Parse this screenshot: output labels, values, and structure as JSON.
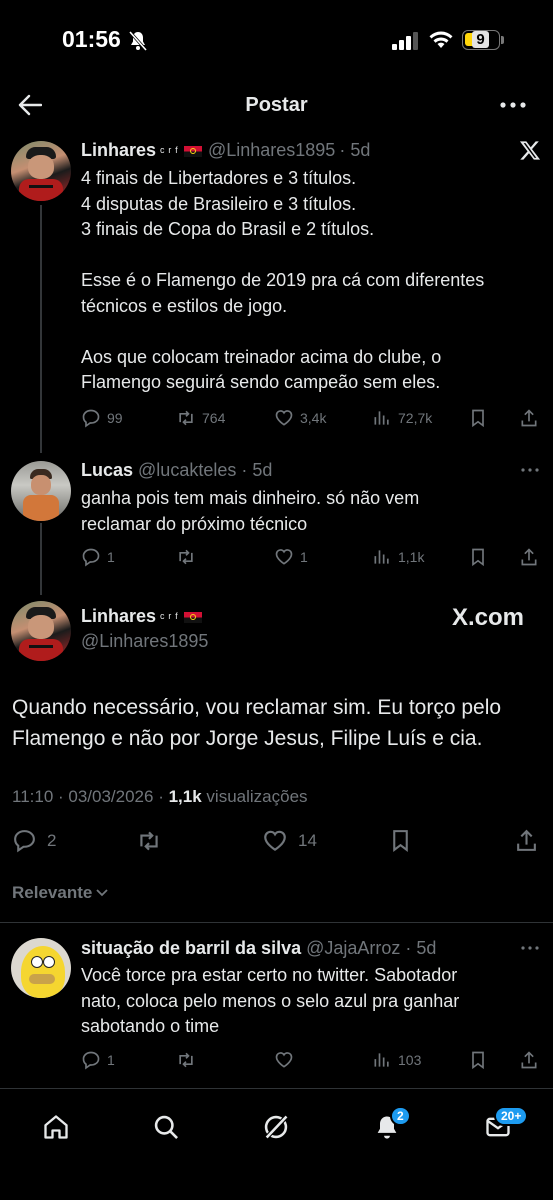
{
  "status_bar": {
    "time": "01:56",
    "battery": "9"
  },
  "header": {
    "title": "Postar"
  },
  "tweet1": {
    "name": "Linhares",
    "name_suffix": "ᶜ ʳ ᶠ",
    "handle": "@Linhares1895",
    "age": "· 5d",
    "lines": [
      "4 finais de Libertadores e 3 títulos.",
      "4 disputas de Brasileiro e 3 títulos.",
      "3 finais de Copa do Brasil e 2 títulos.",
      "",
      "Esse é o Flamengo de 2019 pra cá com diferentes",
      "técnicos e estilos de jogo.",
      "",
      "Aos que colocam treinador acima do clube, o",
      "Flamengo seguirá sendo campeão sem eles."
    ],
    "replies": "99",
    "retweets": "764",
    "likes": "3,4k",
    "views": "72,7k"
  },
  "tweet2": {
    "name": "Lucas",
    "handle": "@lucakteles",
    "age": "· 5d",
    "lines": [
      "ganha pois tem mais dinheiro. só não vem",
      "reclamar do próximo técnico"
    ],
    "replies": "1",
    "likes": "1",
    "views": "1,1k"
  },
  "main_tweet": {
    "name": "Linhares",
    "name_suffix": "ᶜ ʳ ᶠ",
    "handle": "@Linhares1895",
    "watermark": "X.com",
    "lines": [
      "Quando necessário, vou reclamar sim. Eu torço pelo",
      "Flamengo e não por Jorge Jesus, Filipe Luís e cia."
    ],
    "timestamp": "11:10 · 03/03/2026 ·",
    "views_count": "1,1k",
    "views_label": "visualizações",
    "replies": "2",
    "likes": "14"
  },
  "sort": {
    "label": "Relevante"
  },
  "reply1": {
    "name": "situação de barril da silva",
    "handle": "@JajaArroz",
    "age": "· 5d",
    "lines": [
      "Você torce pra estar certo no twitter. Sabotador",
      "nato, coloca pelo menos o selo azul pra ganhar",
      "sabotando o time"
    ],
    "replies": "1",
    "views": "103"
  },
  "nav": {
    "notifications_badge": "2",
    "messages_badge": "20+"
  },
  "colors": {
    "background": "#000000",
    "text": "#e7e9ea",
    "muted": "#71767b",
    "accent": "#1d9bf0",
    "flag_red": "#d21034"
  }
}
